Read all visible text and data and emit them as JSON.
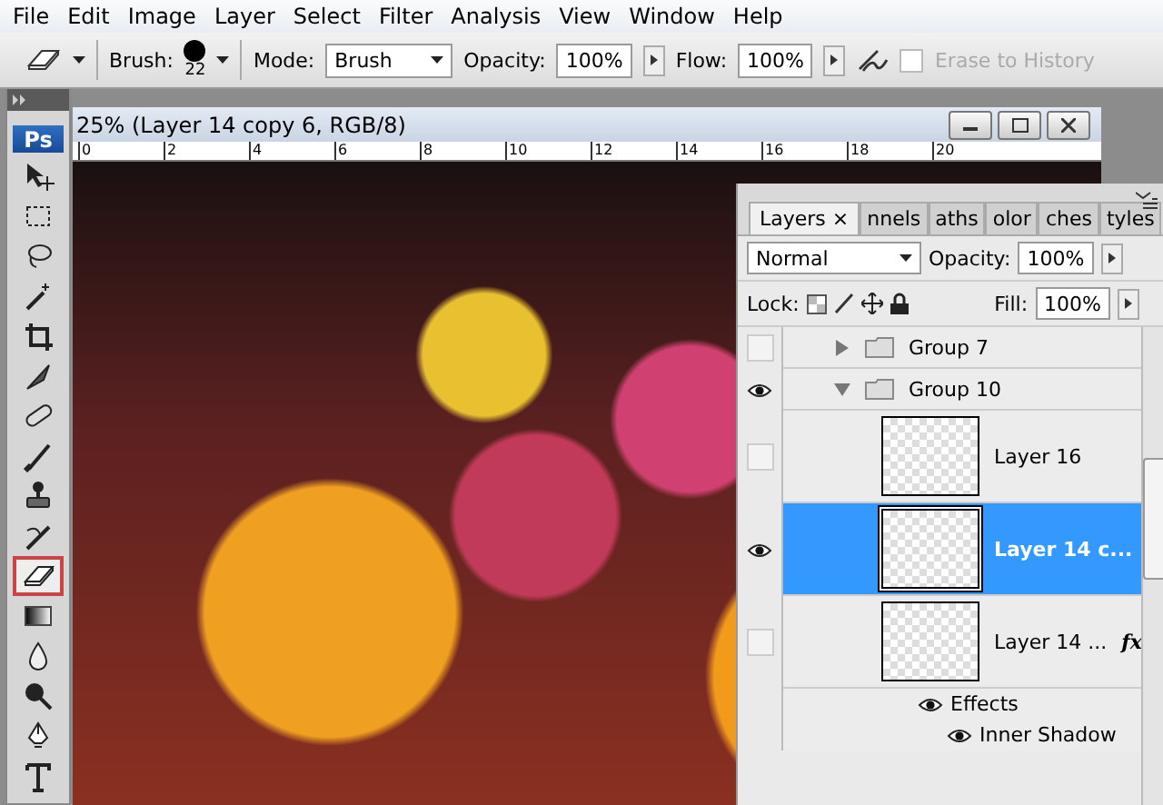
{
  "menu": [
    "File",
    "Edit",
    "Image",
    "Layer",
    "Select",
    "Filter",
    "Analysis",
    "View",
    "Window",
    "Help"
  ],
  "options": {
    "brush_label": "Brush:",
    "brush_size": "22",
    "mode_label": "Mode:",
    "mode": "Brush",
    "opacity_label": "Opacity:",
    "opacity": "100%",
    "flow_label": "Flow:",
    "flow": "100%",
    "erase_to_history": {
      "label": "Erase to History",
      "checked": false,
      "disabled": true
    }
  },
  "toolbox": {
    "logo": "Ps",
    "tools": [
      {
        "kind": "move",
        "selected": false
      },
      {
        "kind": "marquee",
        "selected": false
      },
      {
        "kind": "lasso",
        "selected": false
      },
      {
        "kind": "wand",
        "selected": false
      },
      {
        "kind": "crop",
        "selected": false
      },
      {
        "kind": "slice",
        "selected": false
      },
      {
        "kind": "healing",
        "selected": false
      },
      {
        "kind": "brush",
        "selected": false
      },
      {
        "kind": "stamp",
        "selected": false
      },
      {
        "kind": "history",
        "selected": false
      },
      {
        "kind": "eraser",
        "selected": true
      },
      {
        "kind": "gradient",
        "selected": false
      },
      {
        "kind": "blur",
        "selected": false
      },
      {
        "kind": "dodge",
        "selected": false
      },
      {
        "kind": "pen",
        "selected": false
      },
      {
        "kind": "type",
        "selected": false
      }
    ]
  },
  "document": {
    "title": "25% (Layer 14 copy 6, RGB/8)",
    "ruler": [
      "0",
      "2",
      "4",
      "6",
      "8",
      "10",
      "12",
      "14",
      "16",
      "18",
      "20"
    ]
  },
  "layers_panel": {
    "tabs": [
      {
        "label": "Layers",
        "close": "×",
        "selected": true
      },
      {
        "label": "nnels",
        "selected": false
      },
      {
        "label": "aths",
        "selected": false
      },
      {
        "label": "olor",
        "selected": false
      },
      {
        "label": "ches",
        "selected": false
      },
      {
        "label": "tyles",
        "selected": false
      }
    ],
    "blend_mode": "Normal",
    "opacity_label": "Opacity:",
    "opacity": "100%",
    "lock_label": "Lock:",
    "fill_label": "Fill:",
    "fill": "100%",
    "layers": [
      {
        "kind": "group",
        "name": "Group 7",
        "visible": false,
        "expanded": false,
        "selected": false
      },
      {
        "kind": "group",
        "name": "Group 10",
        "visible": true,
        "expanded": true,
        "selected": false,
        "children": [
          {
            "kind": "layer",
            "name": "Layer 16",
            "visible": false,
            "selected": false
          },
          {
            "kind": "layer",
            "name": "Layer 14 c...",
            "visible": true,
            "selected": true
          },
          {
            "kind": "layer",
            "name": "Layer 14 ...",
            "badge": "fx",
            "visible": false,
            "selected": false,
            "effects": {
              "label": "Effects",
              "items": [
                "Inner Shadow"
              ]
            }
          }
        ]
      }
    ]
  }
}
